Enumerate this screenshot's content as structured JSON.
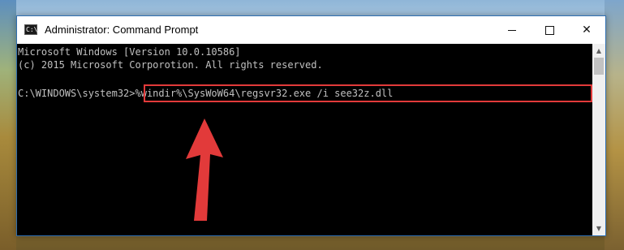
{
  "window": {
    "title": "Administrator: Command Prompt",
    "icon_text": "C:\\"
  },
  "controls": {
    "minimize_icon": "minimize-icon",
    "maximize_icon": "maximize-icon",
    "close_glyph": "✕"
  },
  "console": {
    "line1": "Microsoft Windows [Version 10.0.10586]",
    "line2": "(c) 2015 Microsoft Corporotion. All rights reserved.",
    "prompt": "C:\\WINDOWS\\system32>",
    "command": "%windir%\\SysWoW64\\regsvr32.exe /i see32z.dll"
  },
  "annotation": {
    "highlight_color": "#e23a3a",
    "arrow_color": "#e23a3a"
  },
  "scrollbar": {
    "up_glyph": "▲",
    "down_glyph": "▼"
  }
}
